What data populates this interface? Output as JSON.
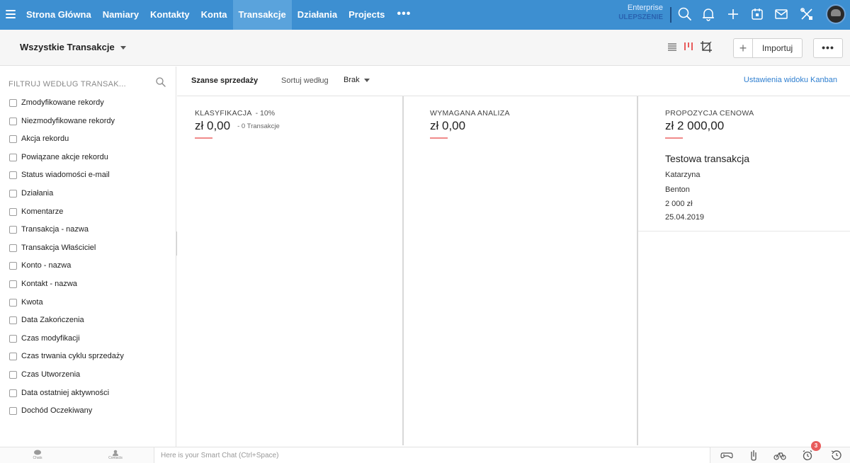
{
  "topnav": {
    "tabs": [
      "Strona Główna",
      "Namiary",
      "Kontakty",
      "Konta",
      "Transakcje",
      "Działania",
      "Projects"
    ],
    "active_tab": "Transakcje",
    "more_label": "•••",
    "edition": "Enterprise",
    "upgrade": "ULEPSZENIE",
    "icons": [
      "search-icon",
      "bell-icon",
      "plus-icon",
      "calendar-icon",
      "mail-icon",
      "tools-icon"
    ],
    "accent_color": "#3d8fd1"
  },
  "subheader": {
    "view_title": "Wszystkie Transakcje",
    "view_icons": [
      "list-view-icon",
      "kanban-view-icon",
      "crop-view-icon"
    ],
    "plus_label": "+",
    "import_label": "Importuj",
    "more_label": "•••"
  },
  "sidebar": {
    "filter_title": "FILTRUJ WEDŁUG TRANSAK...",
    "filters": [
      "Zmodyfikowane rekordy",
      "Niezmodyfikowane rekordy",
      "Akcja rekordu",
      "Powiązane akcje rekordu",
      "Status wiadomości e-mail",
      "Działania",
      "Komentarze",
      "Transakcja - nazwa",
      "Transakcja Właściciel",
      "Konto - nazwa",
      "Kontakt - nazwa",
      "Kwota",
      "Data Zakończenia",
      "Czas modyfikacji",
      "Czas trwania cyklu sprzedaży",
      "Czas Utworzenia",
      "Data ostatniej aktywności",
      "Dochód Oczekiwany"
    ]
  },
  "kanban": {
    "pipeline": "Szanse sprzedaży",
    "sort_label": "Sortuj według",
    "sort_value": "Brak",
    "settings_link": "Ustawienia widoku Kanban",
    "columns": [
      {
        "stage": "KLASYFIKACJA",
        "pct": "- 10%",
        "amount": "zł 0,00",
        "count": "- 0 Transakcje"
      },
      {
        "stage": "WYMAGANA ANALIZA",
        "pct": "",
        "amount": "zł 0,00",
        "count": ""
      },
      {
        "stage": "PROPOZYCJA CENOWA",
        "pct": "",
        "amount": "zł 2 000,00",
        "count": ""
      }
    ],
    "deal": {
      "name": "Testowa transakcja",
      "first_name": "Katarzyna",
      "last_name": "Benton",
      "amount": "2 000 zł",
      "date": "25.04.2019"
    },
    "stage_bar_color": "#f08b8b"
  },
  "bottombar": {
    "chats_label": "Chats",
    "contacts_label": "Contacts",
    "smartchat_placeholder": "Here is your Smart Chat (Ctrl+Space)",
    "icons": [
      "gamepad-icon",
      "clip-icon",
      "bicycle-icon",
      "alarm-clock-icon",
      "history-icon"
    ],
    "badge": "3"
  }
}
